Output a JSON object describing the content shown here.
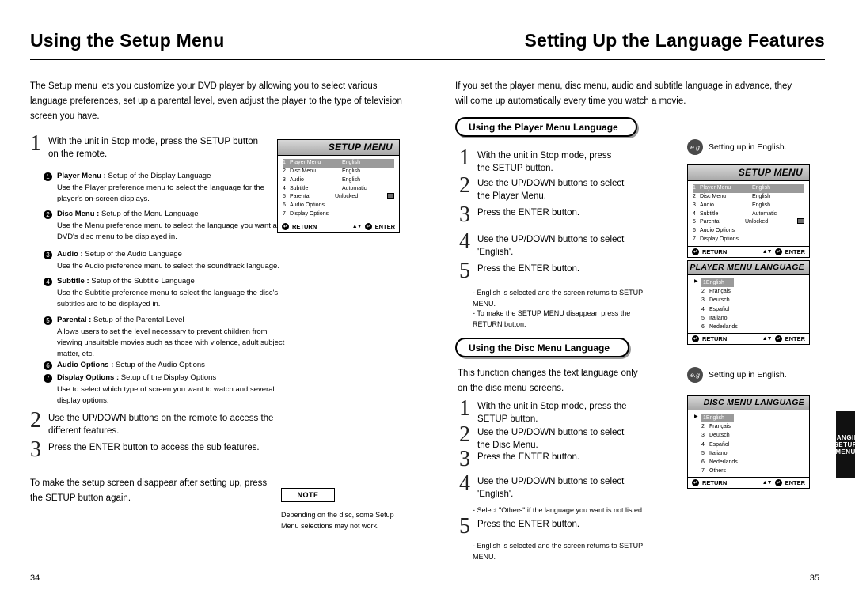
{
  "left_page": {
    "title": "Using the Setup Menu",
    "intro": "The Setup menu lets you customize your DVD player by allowing you to select various language preferences, set up a parental level, even adjust the player to the type of television screen you have.",
    "steps": [
      {
        "num": "1",
        "text": "With the unit in Stop mode, press the SETUP button on the remote."
      },
      {
        "num": "2",
        "text": "Use the UP/DOWN buttons on the remote to access the different features."
      },
      {
        "num": "3",
        "text": "Press the ENTER button to access the sub features."
      }
    ],
    "bullets": [
      {
        "num": "1",
        "title": "Player Menu :",
        "title_rest": "Setup of the Display Language",
        "desc": "Use the Player preference menu to select the language for the player's on-screen displays."
      },
      {
        "num": "2",
        "title": "Disc Menu :",
        "title_rest": "Setup of the Menu Language",
        "desc": "Use the Menu preference menu to select the language you want a DVD's disc menu to be displayed in."
      },
      {
        "num": "3",
        "title": "Audio :",
        "title_rest": "Setup of the Audio Language",
        "desc": "Use the Audio preference menu to select the soundtrack language."
      },
      {
        "num": "4",
        "title": "Subtitle :",
        "title_rest": "Setup of the Subtitle Language",
        "desc": "Use the Subtitle preference menu to select the language the disc's subtitles are to be displayed in."
      },
      {
        "num": "5",
        "title": "Parental :",
        "title_rest": "Setup of the Parental Level",
        "desc": "Allows users to set the level necessary to prevent children from viewing unsuitable movies such as those with violence, adult subject matter, etc."
      },
      {
        "num": "6",
        "title": "Audio Options :",
        "title_rest": "Setup of the Audio Options",
        "desc": ""
      },
      {
        "num": "7",
        "title": "Display Options :",
        "title_rest": "Setup of the Display Options",
        "desc": "Use to select which type of screen you want to watch and several display options."
      }
    ],
    "closing": "To make the setup screen disappear after setting up, press the SETUP button again.",
    "note_label": "NOTE",
    "note_text": "Depending on the disc, some Setup Menu selections may not work.",
    "page_number": "34"
  },
  "setup_menu_left": {
    "title": "SETUP MENU",
    "rows": [
      {
        "n": "1",
        "k": "Player Menu",
        "v": "English",
        "hl": true
      },
      {
        "n": "2",
        "k": "Disc Menu",
        "v": "English",
        "hl": false
      },
      {
        "n": "3",
        "k": "Audio",
        "v": "English",
        "hl": false
      },
      {
        "n": "4",
        "k": "Subtitle",
        "v": "Automatic",
        "hl": false
      },
      {
        "n": "5",
        "k": "Parental",
        "v": "Unlocked",
        "hl": false
      },
      {
        "n": "6",
        "k": "Audio Options",
        "v": "",
        "hl": false
      },
      {
        "n": "7",
        "k": "Display Options",
        "v": "",
        "hl": false
      }
    ],
    "return_label": "RETURN",
    "return_key": "",
    "enter_label": "ENTER",
    "enter_key": ""
  },
  "right_page": {
    "title": "Setting Up the Language Features",
    "intro": "If you set the player menu, disc menu, audio and subtitle language in advance, they will come up automatically every time you watch a movie.",
    "section1": {
      "pill": "Using the Player Menu Language",
      "eg_badge": "e.g",
      "eg_text": "Setting up in English.",
      "steps": [
        {
          "num": "1",
          "text": "With the unit in Stop mode, press the SETUP button."
        },
        {
          "num": "2",
          "text": "Use the UP/DOWN buttons to select the Player Menu."
        },
        {
          "num": "3",
          "text": "Press the ENTER button."
        },
        {
          "num": "4",
          "text": "Use the UP/DOWN buttons to select 'English'."
        },
        {
          "num": "5",
          "text": "Press the ENTER button."
        }
      ],
      "hints": [
        "- English is selected and the screen returns to SETUP MENU.",
        "- To make the SETUP MENU disappear, press the RETURN button."
      ]
    },
    "section2": {
      "pill": "Using the Disc Menu Language",
      "eg_badge": "e.g",
      "eg_text": "Setting up in English.",
      "lead": "This function changes the text language only on the disc menu screens.",
      "steps": [
        {
          "num": "1",
          "text": "With the unit in Stop mode, press the SETUP button."
        },
        {
          "num": "2",
          "text": "Use the UP/DOWN buttons to select the Disc Menu."
        },
        {
          "num": "3",
          "text": "Press the ENTER button."
        },
        {
          "num": "4",
          "text": "Use the UP/DOWN buttons to select 'English'."
        },
        {
          "num": "5",
          "text": "Press the ENTER button."
        }
      ],
      "hints": [
        "- Select \"Others\" if the language you want is not listed.",
        "- English is selected and the screen returns to SETUP MENU."
      ]
    },
    "side_tab": "CHANGING SETUP MENU",
    "page_number": "35"
  },
  "setup_menu_right": {
    "title": "SETUP MENU",
    "rows": [
      {
        "n": "1",
        "k": "Player Menu",
        "v": "English",
        "hl": true
      },
      {
        "n": "2",
        "k": "Disc Menu",
        "v": "English",
        "hl": false
      },
      {
        "n": "3",
        "k": "Audio",
        "v": "English",
        "hl": false
      },
      {
        "n": "4",
        "k": "Subtitle",
        "v": "Automatic",
        "hl": false
      },
      {
        "n": "5",
        "k": "Parental",
        "v": "Unlocked",
        "hl": false
      },
      {
        "n": "6",
        "k": "Audio Options",
        "v": "",
        "hl": false
      },
      {
        "n": "7",
        "k": "Display Options",
        "v": "",
        "hl": false
      }
    ],
    "return_label": "RETURN",
    "enter_label": "ENTER"
  },
  "player_menu_language": {
    "title": "PLAYER MENU LANGUAGE",
    "rows": [
      {
        "n": "1",
        "lbl": "English",
        "hl": true
      },
      {
        "n": "2",
        "lbl": "Français",
        "hl": false
      },
      {
        "n": "3",
        "lbl": "Deutsch",
        "hl": false
      },
      {
        "n": "4",
        "lbl": "Español",
        "hl": false
      },
      {
        "n": "5",
        "lbl": "Italiano",
        "hl": false
      },
      {
        "n": "6",
        "lbl": "Nederlands",
        "hl": false
      }
    ],
    "return_label": "RETURN",
    "enter_label": "ENTER"
  },
  "disc_menu_language": {
    "title": "DISC MENU LANGUAGE",
    "rows": [
      {
        "n": "1",
        "lbl": "English",
        "hl": true
      },
      {
        "n": "2",
        "lbl": "Français",
        "hl": false
      },
      {
        "n": "3",
        "lbl": "Deutsch",
        "hl": false
      },
      {
        "n": "4",
        "lbl": "Español",
        "hl": false
      },
      {
        "n": "5",
        "lbl": "Italiano",
        "hl": false
      },
      {
        "n": "6",
        "lbl": "Nederlands",
        "hl": false
      },
      {
        "n": "7",
        "lbl": "Others",
        "hl": false
      }
    ],
    "return_label": "RETURN",
    "enter_label": "ENTER"
  }
}
